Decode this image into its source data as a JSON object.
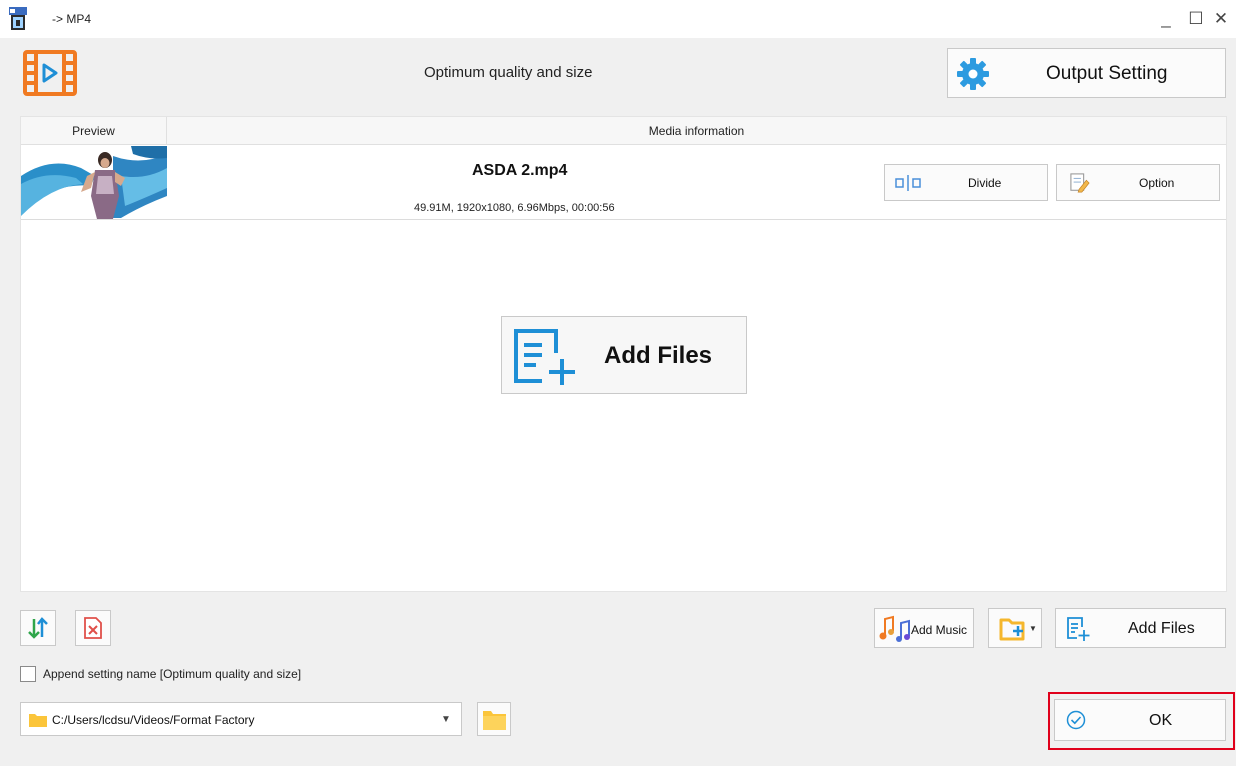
{
  "window": {
    "title": "-> MP4",
    "minimize_glyph": "_",
    "maximize_glyph": "☐",
    "close_glyph": "✕"
  },
  "header": {
    "format_icon": "video-film-icon",
    "quality_label": "Optimum quality and size",
    "output_setting_label": "Output Setting",
    "output_setting_icon": "gear-icon"
  },
  "file_list": {
    "columns": [
      "Preview",
      "Media information"
    ],
    "files": [
      {
        "name": "ASDA 2.mp4",
        "info": "49.91M, 1920x1080, 6.96Mbps, 00:00:56",
        "divide_label": "Divide",
        "option_label": "Option"
      }
    ],
    "add_files_label": "Add Files"
  },
  "toolbar": {
    "sort_icon": "sort-arrows-icon",
    "remove_icon": "remove-file-icon",
    "add_music_label": "Add Music",
    "add_folder_icon": "add-folder-icon",
    "add_files_label": "Add Files"
  },
  "options": {
    "append_setting_label": "Append setting name [Optimum quality and size]",
    "append_checked": false
  },
  "output_path": {
    "value": "C:/Users/lcdsu/Videos/Format Factory",
    "dropdown_glyph": "▼"
  },
  "actions": {
    "ok_label": "OK"
  },
  "colors": {
    "accent_orange": "#f07a22",
    "accent_blue": "#1e8fd6",
    "highlight_red": "#e0001b",
    "folder_yellow": "#fbc53a"
  }
}
